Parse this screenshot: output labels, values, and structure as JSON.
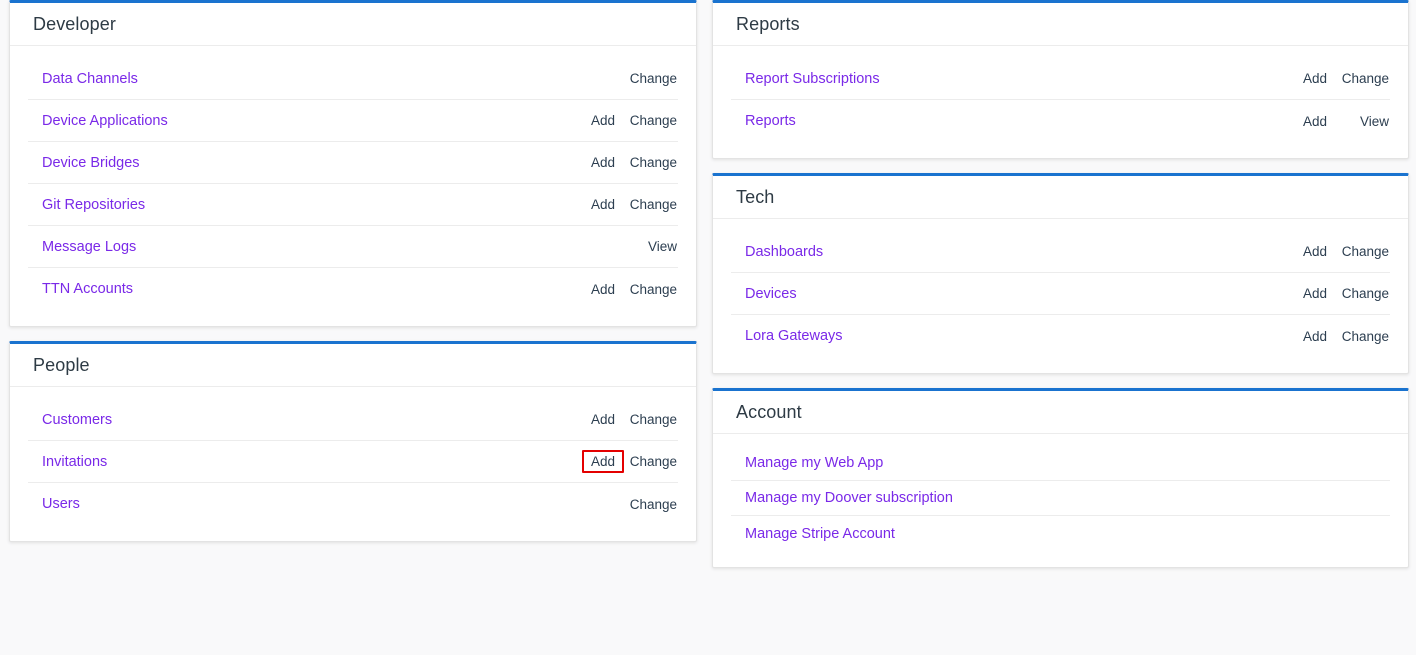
{
  "colors": {
    "panel_top_border": "#1a73cf",
    "link": "#7a29e8",
    "action_text": "#2c3e50",
    "page_background": "#f9f9fa",
    "highlight_box": "#e40000"
  },
  "left_column": [
    {
      "title": "Developer",
      "rows": [
        {
          "label": "Data Channels",
          "add": "",
          "change": "Change"
        },
        {
          "label": "Device Applications",
          "add": "Add",
          "change": "Change"
        },
        {
          "label": "Device Bridges",
          "add": "Add",
          "change": "Change"
        },
        {
          "label": "Git Repositories",
          "add": "Add",
          "change": "Change"
        },
        {
          "label": "Message Logs",
          "add": "",
          "change": "View"
        },
        {
          "label": "TTN Accounts",
          "add": "Add",
          "change": "Change"
        }
      ]
    },
    {
      "title": "People",
      "rows": [
        {
          "label": "Customers",
          "add": "Add",
          "change": "Change"
        },
        {
          "label": "Invitations",
          "add": "Add",
          "change": "Change",
          "highlighted_action": "add"
        },
        {
          "label": "Users",
          "add": "",
          "change": "Change"
        }
      ]
    }
  ],
  "right_column": [
    {
      "title": "Reports",
      "rows": [
        {
          "label": "Report Subscriptions",
          "add": "Add",
          "change": "Change"
        },
        {
          "label": "Reports",
          "add": "Add",
          "change": "View"
        }
      ]
    },
    {
      "title": "Tech",
      "rows": [
        {
          "label": "Dashboards",
          "add": "Add",
          "change": "Change"
        },
        {
          "label": "Devices",
          "add": "Add",
          "change": "Change"
        },
        {
          "label": "Lora Gateways",
          "add": "Add",
          "change": "Change"
        }
      ]
    },
    {
      "title": "Account",
      "links": [
        {
          "label": "Manage my Web App"
        },
        {
          "label": "Manage my Doover subscription"
        },
        {
          "label": "Manage Stripe Account"
        }
      ]
    }
  ]
}
